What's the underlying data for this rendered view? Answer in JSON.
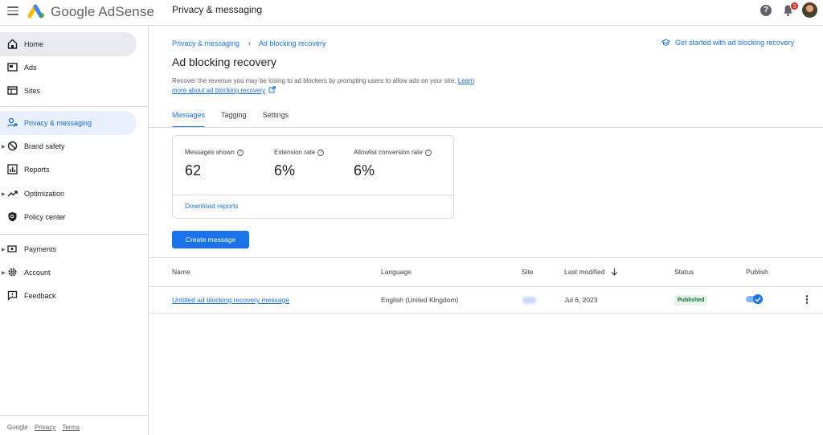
{
  "header": {
    "brand": "Google AdSense",
    "title": "Privacy & messaging",
    "notification_count": "3",
    "help_glyph": "?"
  },
  "sidebar": {
    "items": [
      {
        "label": "Home",
        "icon": "home-icon"
      },
      {
        "label": "Ads",
        "icon": "ads-icon"
      },
      {
        "label": "Sites",
        "icon": "sites-icon"
      },
      {
        "label": "Privacy & messaging",
        "icon": "privacy-icon"
      },
      {
        "label": "Brand safety",
        "icon": "block-icon"
      },
      {
        "label": "Reports",
        "icon": "bar-chart-icon"
      },
      {
        "label": "Optimization",
        "icon": "trending-icon"
      },
      {
        "label": "Policy center",
        "icon": "policy-shield-icon"
      },
      {
        "label": "Payments",
        "icon": "payments-icon"
      },
      {
        "label": "Account",
        "icon": "gear-icon"
      },
      {
        "label": "Feedback",
        "icon": "feedback-icon"
      }
    ],
    "footer": {
      "google": "Google",
      "privacy": "Privacy",
      "terms": "Terms"
    }
  },
  "main": {
    "breadcrumb": [
      "Privacy & messaging",
      "Ad blocking recovery"
    ],
    "get_started": "Get started with ad blocking recovery",
    "title": "Ad blocking recovery",
    "description": "Recover the revenue you may be losing to ad blockers by prompting users to allow ads on your site.",
    "learn_more": "Learn more about ad blocking recovery",
    "tabs": [
      "Messages",
      "Tagging",
      "Settings"
    ],
    "metrics": [
      {
        "label": "Messages shown",
        "value": "62"
      },
      {
        "label": "Extension rate",
        "value": "6%"
      },
      {
        "label": "Allowlist conversion rate",
        "value": "6%"
      }
    ],
    "download_reports": "Download reports",
    "create_button": "Create message",
    "table": {
      "headers": [
        "Name",
        "Language",
        "Site",
        "Last modified",
        "Status",
        "Publish"
      ],
      "rows": [
        {
          "name": "Untitled ad blocking recovery message",
          "language": "English (United Kingdom)",
          "last_modified": "Jul 6, 2023",
          "status": "Published",
          "published": true
        }
      ]
    }
  },
  "colors": {
    "accent": "#1a73e8",
    "active_nav_bg": "#e8f0fe",
    "published_bg": "#e6f4ea",
    "published_text": "#137333"
  }
}
